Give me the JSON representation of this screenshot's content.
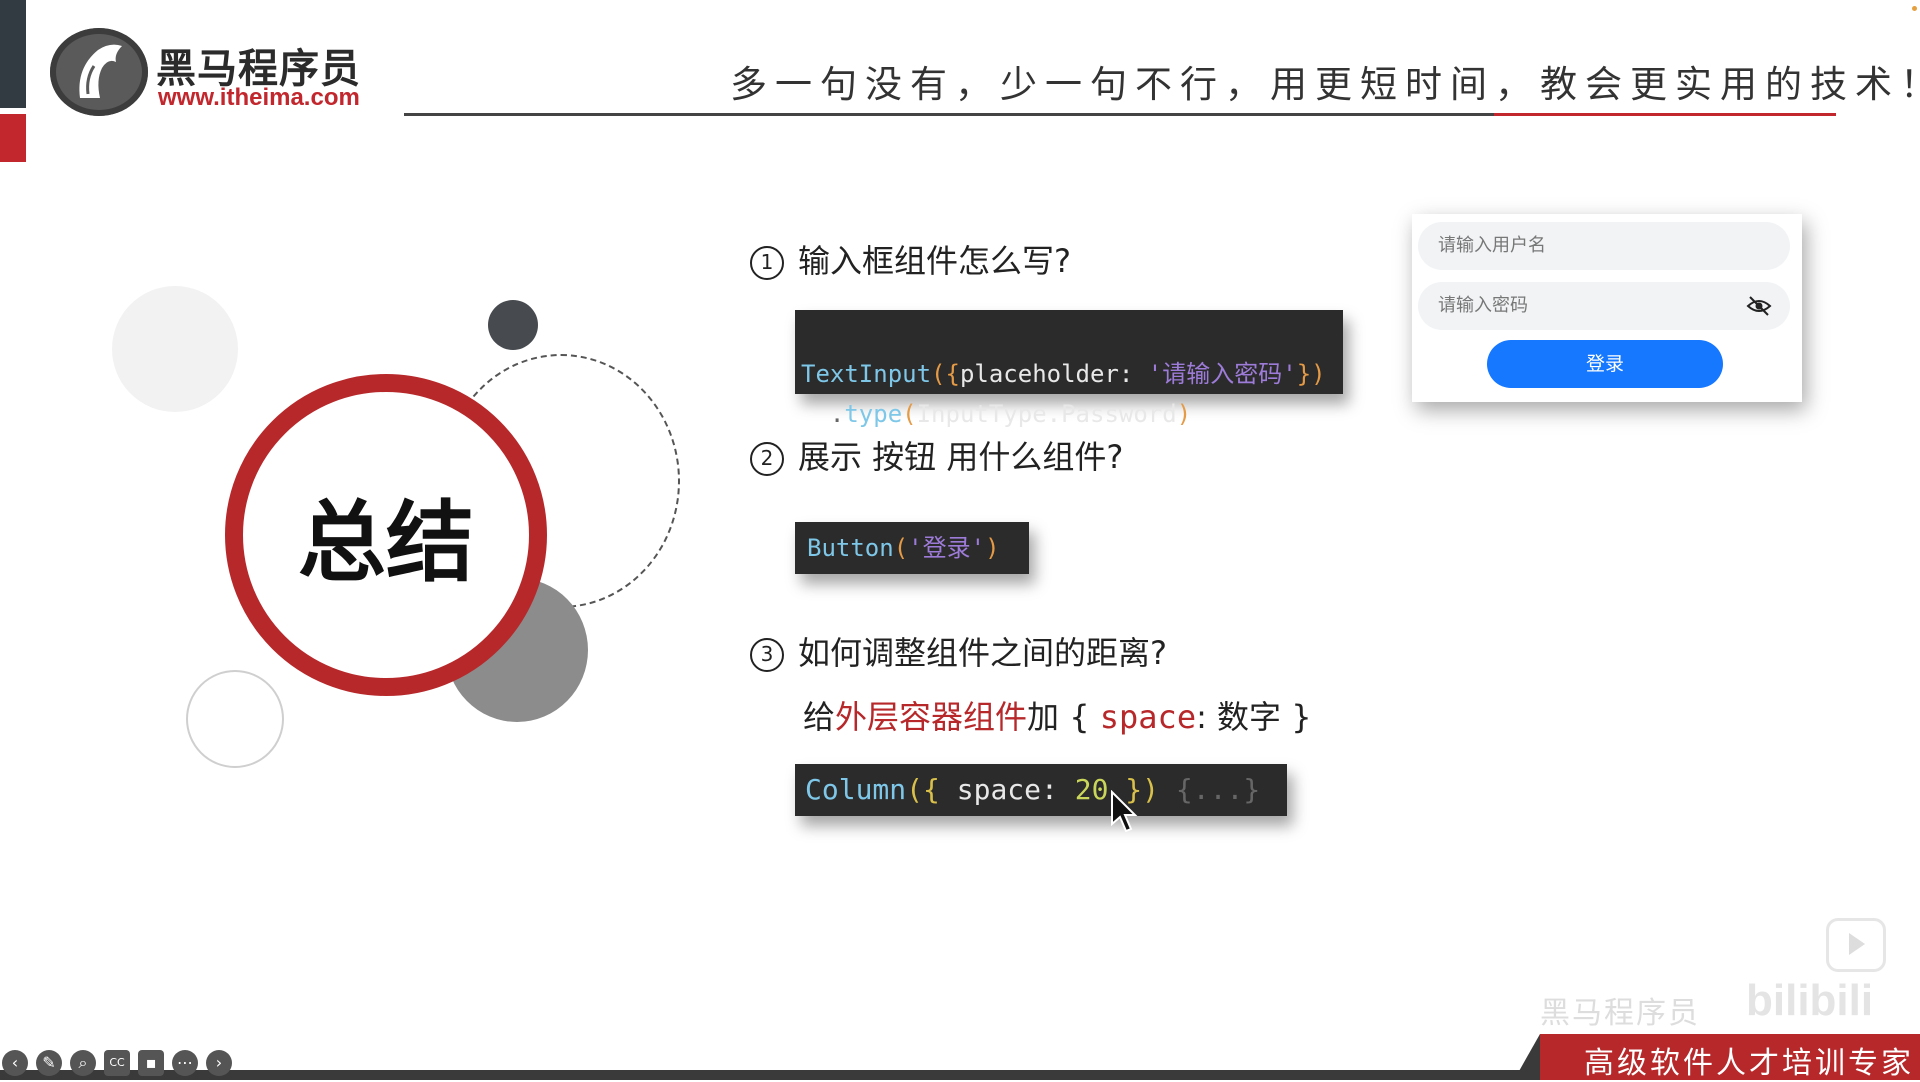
{
  "header": {
    "logo_cn": "黑马程序员",
    "logo_url": "www.itheima.com",
    "slogan": "多一句没有，少一句不行，用更短时间，教会更实用的技术！"
  },
  "summary": {
    "title": "总结"
  },
  "questions": [
    {
      "num": "1",
      "text": "输入框组件怎么写?"
    },
    {
      "num": "2",
      "text": "展示  按钮  用什么组件?"
    },
    {
      "num": "3",
      "text": "如何调整组件之间的距离?"
    }
  ],
  "code1": {
    "line1_fn": "TextInput",
    "line1_open": "({",
    "line1_key": "placeholder: ",
    "line1_str": "'请输入密码'",
    "line1_close": "})",
    "line2_dot": "  .",
    "line2_fn": "type",
    "line2_open": "(",
    "line2_arg": "InputType.Password",
    "line2_close": ")"
  },
  "code2": {
    "fn": "Button",
    "open": "(",
    "str": "'登录'",
    "close": ")"
  },
  "answer3": {
    "prefix": "给",
    "highlight": "外层容器组件",
    "mid": "加 { ",
    "key": "space",
    "colon": ": 数字 }"
  },
  "code3": {
    "fn": "Column",
    "open": "({",
    "key": " space: ",
    "num": "20",
    "close": " })",
    "rest": " {...}"
  },
  "login_mock": {
    "username_placeholder": "请输入用户名",
    "password_placeholder": "请输入密码",
    "button_label": "登录"
  },
  "footer": {
    "tagline": "高级软件人才培训专家",
    "watermark_cn": "黑马程序员",
    "watermark_logo": "bilibili"
  },
  "toolbar_icons": [
    "back-icon",
    "pen-icon",
    "search-icon",
    "cc-icon",
    "camera-icon",
    "more-icon",
    "forward-icon"
  ]
}
